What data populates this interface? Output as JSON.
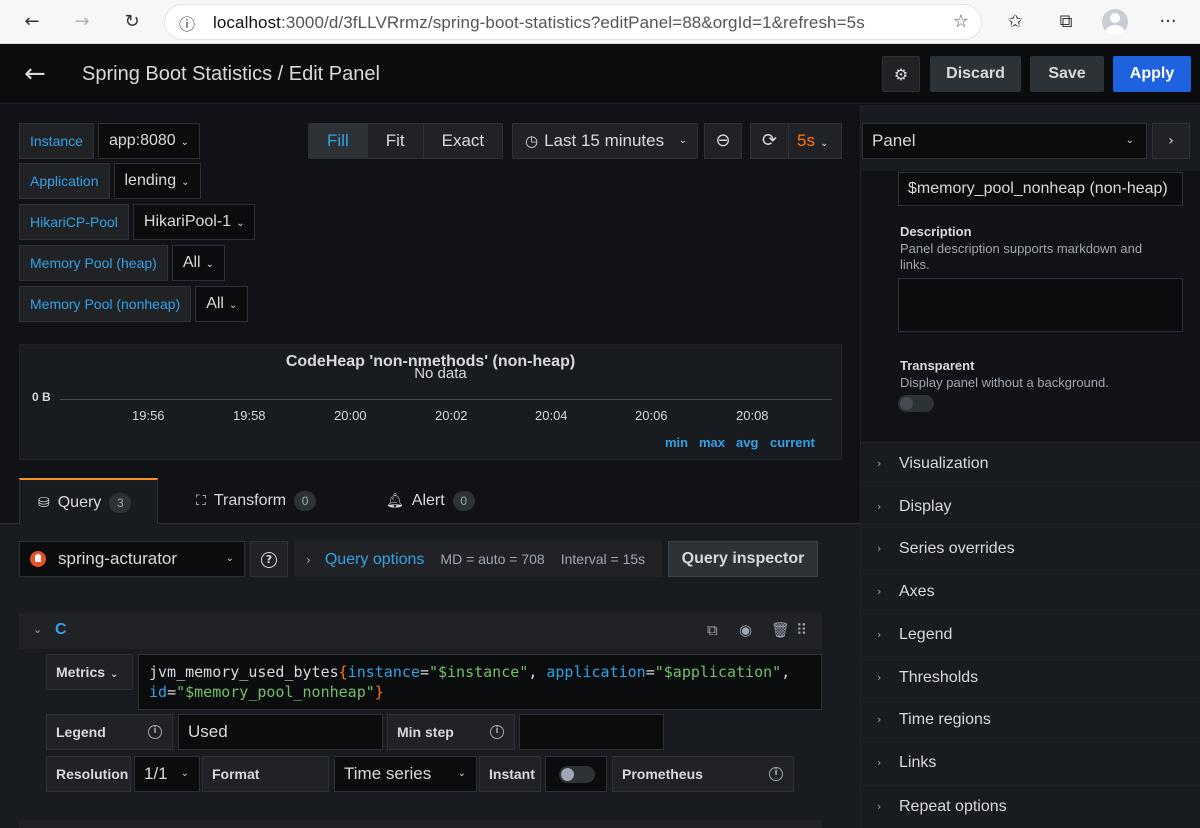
{
  "browser": {
    "url_host": "localhost",
    "url_rest": ":3000/d/3fLLVRrmz/spring-boot-statistics?editPanel=88&orgId=1&refresh=5s"
  },
  "header": {
    "title": "Spring Boot Statistics / Edit Panel",
    "discard": "Discard",
    "save": "Save",
    "apply": "Apply"
  },
  "variables": [
    {
      "label": "Instance",
      "value": "app:8080"
    },
    {
      "label": "Application",
      "value": "lending"
    },
    {
      "label": "HikariCP-Pool",
      "value": "HikariPool-1"
    },
    {
      "label": "Memory Pool (heap)",
      "value": "All"
    },
    {
      "label": "Memory Pool (nonheap)",
      "value": "All"
    }
  ],
  "toolbar": {
    "fill": "Fill",
    "fit": "Fit",
    "exact": "Exact",
    "time_range": "Last 15 minutes",
    "refresh_interval": "5s"
  },
  "preview": {
    "title": "CodeHeap 'non-nmethods' (non-heap)",
    "no_data": "No data",
    "y_label": "0 B",
    "x_ticks": [
      "19:56",
      "19:58",
      "20:00",
      "20:02",
      "20:04",
      "20:06",
      "20:08"
    ],
    "legend": [
      "min",
      "max",
      "avg",
      "current"
    ]
  },
  "tabs": [
    {
      "label": "Query",
      "count": "3"
    },
    {
      "label": "Transform",
      "count": "0"
    },
    {
      "label": "Alert",
      "count": "0"
    }
  ],
  "query": {
    "datasource": "spring-acturator",
    "options_title": "Query options",
    "md": "MD = auto = 708",
    "interval": "Interval = 15s",
    "inspector": "Query inspector",
    "ref_id": "C",
    "metrics_label": "Metrics",
    "expr": {
      "fn": "jvm_memory_used_bytes",
      "k1": "instance",
      "v1": "\"$instance\"",
      "k2": "application",
      "v2": "\"$application\"",
      "k3": "id",
      "v3": "\"$memory_pool_nonheap\""
    },
    "legend_label": "Legend",
    "legend_value": "Used",
    "minstep_label": "Min step",
    "resolution_label": "Resolution",
    "resolution_value": "1/1",
    "format_label": "Format",
    "format_value": "Time series",
    "instant_label": "Instant",
    "prometheus_label": "Prometheus"
  },
  "options": {
    "tab": "Panel",
    "title_value": "$memory_pool_nonheap (non-heap)",
    "description_label": "Description",
    "description_help": "Panel description supports markdown and links.",
    "transparent_label": "Transparent",
    "transparent_help": "Display panel without a background.",
    "sections": [
      "Visualization",
      "Display",
      "Series overrides",
      "Axes",
      "Legend",
      "Thresholds",
      "Time regions",
      "Links",
      "Repeat options"
    ]
  }
}
